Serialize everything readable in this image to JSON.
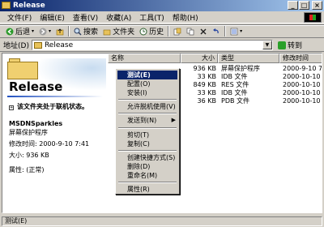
{
  "window": {
    "title": "Release"
  },
  "menubar": {
    "items": [
      "文件(F)",
      "编辑(E)",
      "查看(V)",
      "收藏(A)",
      "工具(T)",
      "帮助(H)"
    ]
  },
  "toolbar": {
    "back": "后退",
    "search": "搜索",
    "folders": "文件夹",
    "history": "历史"
  },
  "address": {
    "label": "地址(D)",
    "value": "Release",
    "go": "转到"
  },
  "leftpane": {
    "title": "Release",
    "offline_note": "该文件夹处于联机状态。",
    "file_name": "MSDNSparkles",
    "file_type": "屏幕保护程序",
    "modified": "修改时间: 2000-9-10 7:41",
    "size": "大小: 936 KB",
    "attributes": "属性: (正常)"
  },
  "list": {
    "columns": [
      "名称",
      "大小",
      "类型",
      "修改时间"
    ],
    "rows": [
      {
        "name": "",
        "size": "936 KB",
        "type": "屏幕保护程序",
        "modified": "2000-9-10 7:"
      },
      {
        "name": "",
        "size": "33 KB",
        "type": "IDB 文件",
        "modified": "2000-10-10 2"
      },
      {
        "name": "",
        "size": "849 KB",
        "type": "RES 文件",
        "modified": "2000-10-10 2"
      },
      {
        "name": "",
        "size": "33 KB",
        "type": "IDB 文件",
        "modified": "2000-10-10 2"
      },
      {
        "name": "",
        "size": "36 KB",
        "type": "PDB 文件",
        "modified": "2000-10-10 2"
      }
    ]
  },
  "context_menu": {
    "items": [
      "测试(E)",
      "配置(O)",
      "安装(I)",
      "允许脱机使用(V)",
      "发送到(N)",
      "剪切(T)",
      "复制(C)",
      "创建快捷方式(S)",
      "删除(D)",
      "重命名(M)",
      "属性(R)"
    ]
  },
  "status": {
    "text": "测试(E)"
  }
}
